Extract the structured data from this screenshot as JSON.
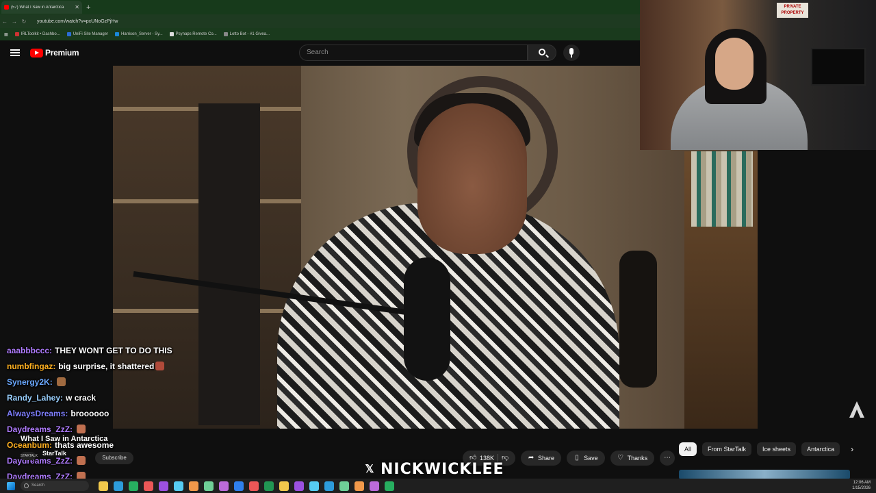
{
  "browser": {
    "tab_title": "(57) What I Saw in Antarctica",
    "url": "youtube.com/watch?v=pxUNoGzPjHw",
    "bookmarks": [
      "IRLToolkit • Dashbo...",
      "UniFi Site Manager",
      "Harrison_Server - Sy...",
      "Psynaps Remote Co...",
      "Lotto Bot - #1 Givea..."
    ]
  },
  "youtube": {
    "brand": "Premium",
    "search_placeholder": "Search",
    "video_title": "What I Saw in Antarctica",
    "channel": "StarTalk",
    "channel_avatar": "STARTALK",
    "subscribe_label": "Subscribe",
    "likes": "138K",
    "share_label": "Share",
    "save_label": "Save",
    "thanks_label": "Thanks",
    "chips": [
      "All",
      "From StarTalk",
      "Ice sheets",
      "Antarctica"
    ]
  },
  "webcam": {
    "sign_text": "PRIVATE PROPERTY"
  },
  "chat": [
    {
      "user": "aaabbbccc:",
      "color": "#b07cff",
      "msg": "THEY WONT GET TO DO THIS",
      "emote": ""
    },
    {
      "user": "numbfingaz:",
      "color": "#ffb020",
      "msg": "big surprise, it shattered",
      "emote": "#b04a3a"
    },
    {
      "user": "Synergy2K:",
      "color": "#6aa8ff",
      "msg": "",
      "emote": "#a06a40"
    },
    {
      "user": "Randy_Lahey:",
      "color": "#9ad0ff",
      "msg": "w crack",
      "emote": ""
    },
    {
      "user": "AlwaysDreams:",
      "color": "#7f7fff",
      "msg": "broooooo",
      "emote": ""
    },
    {
      "user": "Daydreams_ZzZ:",
      "color": "#b07cff",
      "msg": "",
      "emote": "#c07050"
    },
    {
      "user": "Oceanbum:",
      "color": "#ffb020",
      "msg": "thats awesome",
      "emote": ""
    },
    {
      "user": "Daydreams_ZzZ:",
      "color": "#b07cff",
      "msg": "",
      "emote": "#c07050"
    },
    {
      "user": "Daydreams_ZzZ:",
      "color": "#b07cff",
      "msg": "",
      "emote": "#c07050"
    }
  ],
  "streamer_handle": "NICKWICKLEE",
  "taskbar": {
    "search_placeholder": "Search",
    "time": "12:06 AM",
    "date": "1/15/2026",
    "icon_colors": [
      "#f2c94c",
      "#2d9cdb",
      "#27ae60",
      "#eb5757",
      "#9b51e0",
      "#56ccf2",
      "#f2994a",
      "#6fcf97",
      "#bb6bd9",
      "#2f80ed",
      "#eb5757",
      "#219653",
      "#f2c94c",
      "#9b51e0",
      "#56ccf2",
      "#2d9cdb",
      "#6fcf97",
      "#f2994a",
      "#bb6bd9",
      "#27ae60"
    ]
  }
}
